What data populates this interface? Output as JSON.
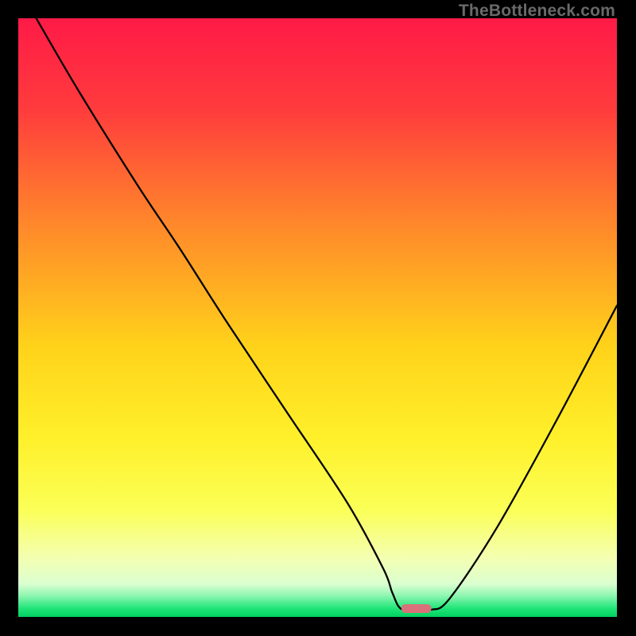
{
  "watermark": "TheBottleneck.com",
  "chart_data": {
    "type": "line",
    "title": "",
    "xlabel": "",
    "ylabel": "",
    "xlim": [
      0,
      100
    ],
    "ylim": [
      0,
      100
    ],
    "gradient_stops": [
      {
        "offset": 0.0,
        "color": "#ff1a47"
      },
      {
        "offset": 0.15,
        "color": "#ff3b3d"
      },
      {
        "offset": 0.35,
        "color": "#ff8a2a"
      },
      {
        "offset": 0.55,
        "color": "#ffd31a"
      },
      {
        "offset": 0.7,
        "color": "#fff02a"
      },
      {
        "offset": 0.82,
        "color": "#fbff56"
      },
      {
        "offset": 0.9,
        "color": "#f4ffb0"
      },
      {
        "offset": 0.945,
        "color": "#dbffd0"
      },
      {
        "offset": 0.965,
        "color": "#8cf5b0"
      },
      {
        "offset": 0.985,
        "color": "#22e67a"
      },
      {
        "offset": 1.0,
        "color": "#00d060"
      }
    ],
    "series": [
      {
        "name": "bottleneck-curve",
        "x": [
          3,
          10,
          20,
          27,
          35,
          45,
          55,
          61,
          62.5,
          64,
          67,
          69,
          72,
          80,
          90,
          100
        ],
        "y": [
          100,
          88,
          72,
          61.5,
          49,
          34,
          19,
          8,
          4,
          1.3,
          1.2,
          1.2,
          3,
          15,
          33,
          52
        ]
      }
    ],
    "marker": {
      "x_start": 64,
      "x_end": 69,
      "y": 1.4,
      "color": "#d9717b"
    }
  }
}
